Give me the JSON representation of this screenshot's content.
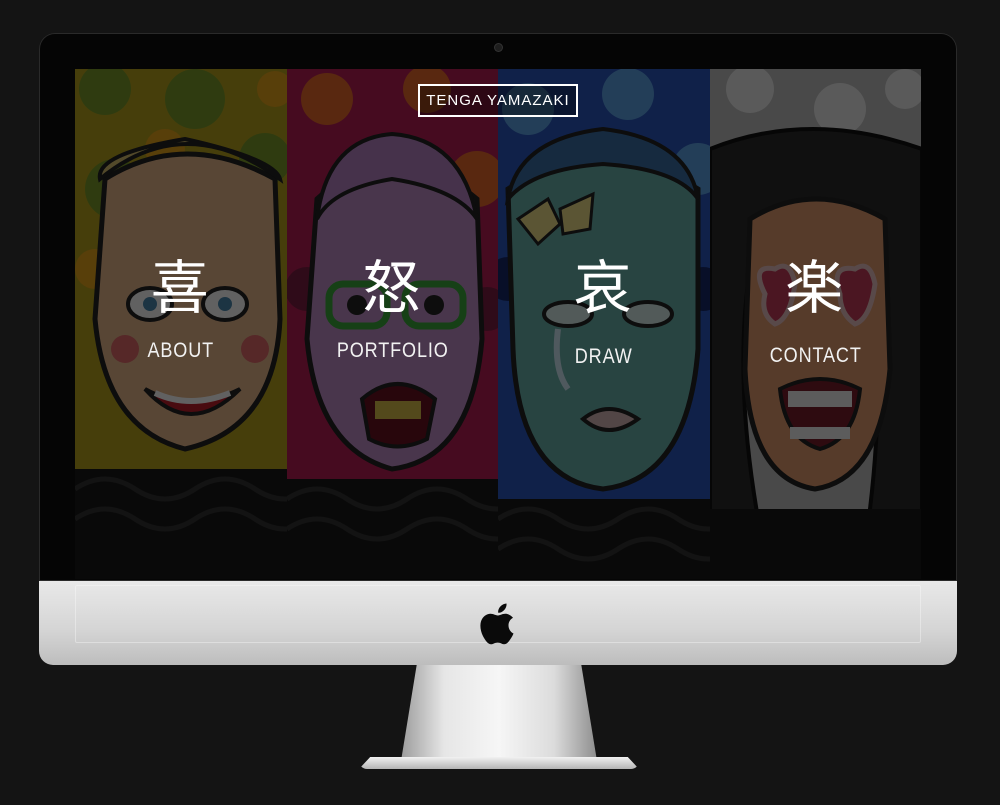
{
  "site": {
    "logo_text": "TENGA YAMAZAKI"
  },
  "panels": [
    {
      "kanji": "喜",
      "label": "ABOUT",
      "pattern_colors": [
        "#a2b433",
        "#e9a21c",
        "#3d6b2a"
      ],
      "face_color": "#e6b78d"
    },
    {
      "kanji": "怒",
      "label": "PORTFOLIO",
      "pattern_colors": [
        "#c9265b",
        "#e86b2c",
        "#5a1b3a"
      ],
      "face_color": "#c799d8"
    },
    {
      "kanji": "哀",
      "label": "DRAW",
      "pattern_colors": [
        "#2f62c9",
        "#5fa0e6",
        "#1a2f74"
      ],
      "face_color": "#86c6bf"
    },
    {
      "kanji": "楽",
      "label": "CONTACT",
      "pattern_colors": [
        "#c8c8c8",
        "#7fa06b",
        "#e0e0e0"
      ],
      "face_color": "#e7a679"
    }
  ],
  "device": {
    "brand_icon": "apple-logo-icon",
    "camera_icon": "camera-icon"
  }
}
